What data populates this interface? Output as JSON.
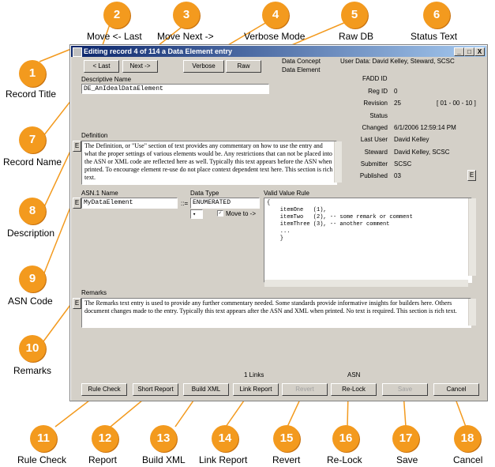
{
  "callouts": [
    {
      "num": "1",
      "label": "Record Title"
    },
    {
      "num": "2",
      "label": "Move <- Last"
    },
    {
      "num": "3",
      "label": "Move Next ->"
    },
    {
      "num": "4",
      "label": "Verbose Mode"
    },
    {
      "num": "5",
      "label": "Raw DB"
    },
    {
      "num": "6",
      "label": "Status Text"
    },
    {
      "num": "7",
      "label": "Record Name"
    },
    {
      "num": "8",
      "label": "Description"
    },
    {
      "num": "9",
      "label": "ASN Code"
    },
    {
      "num": "10",
      "label": "Remarks"
    },
    {
      "num": "11",
      "label": "Rule Check"
    },
    {
      "num": "12",
      "label": "Report"
    },
    {
      "num": "13",
      "label": "Build XML"
    },
    {
      "num": "14",
      "label": "Link Report"
    },
    {
      "num": "15",
      "label": "Revert"
    },
    {
      "num": "16",
      "label": "Re-Lock"
    },
    {
      "num": "17",
      "label": "Save"
    },
    {
      "num": "18",
      "label": "Cancel"
    }
  ],
  "window": {
    "title": "Editing record 4 of 114 a Data Element entry",
    "minimize": "_",
    "maximize": "□",
    "close": "X"
  },
  "toolbar": {
    "last_label": "< Last",
    "next_label": "Next ->",
    "verbose_label": "Verbose",
    "raw_label": "Raw",
    "concept_line1": "Data Concept",
    "concept_line2": "Data Element",
    "user_data": "User Data:  David Kelley, Steward, SCSC"
  },
  "descriptive_name": {
    "label": "Descriptive Name",
    "value": "DE_AnIdealDataElement"
  },
  "status": {
    "fadd_id": "FADD ID",
    "rows": [
      {
        "label": "Reg ID",
        "value": "0"
      },
      {
        "label": "Revision",
        "value": "25"
      },
      {
        "label": "Status",
        "value": ""
      },
      {
        "label": "Changed",
        "value": "6/1/2006 12:59:14 PM"
      },
      {
        "label": "Last User",
        "value": "David Kelley"
      },
      {
        "label": "Steward",
        "value": "David Kelley, SCSC"
      },
      {
        "label": "Submitter",
        "value": "SCSC"
      },
      {
        "label": "Published",
        "value": "03"
      }
    ],
    "revision_range": "[ 01 - 00 - 10 ]",
    "edit_button": "E"
  },
  "definition": {
    "label": "Definition",
    "edit_button": "E",
    "text": "The Definition, or \"Use\" section of text provides any commentary on how to use the entry and what the proper settings of various elements would be.  Any restrictions that can not be placed into the ASN or XML code are reflected here as well. Typically this text appears before the ASN when printed.  To encourage element re-use do not place context dependent text here.  This section is rich text."
  },
  "asn": {
    "name_label": "ASN.1 Name",
    "name_value": "MyDataElement",
    "edit_button": "E",
    "assign": "::=",
    "type_label": "Data Type",
    "type_value": "ENUMERATED",
    "move_to": "Move to ->",
    "rule_label": "Valid Value Rule",
    "rule_code": "{\n    itemOne   (1),\n    itemTwo   (2), -- some remark or comment\n    itemThree (3), -- another comment\n    ...\n    }"
  },
  "remarks": {
    "label": "Remarks",
    "edit_button": "E",
    "text": "The Remarks text entry is used to provide any further commentary needed. Some standards provide informative insights for builders here. Others document changes made to the entry.  Typically this text appears after the ASN and XML when printed.  No text is required.  This section is rich text."
  },
  "bottom": {
    "links_count": "1 Links",
    "asn_label": "ASN",
    "rule_check": "Rule Check",
    "short_report": "Short Report",
    "build_xml": "Build XML",
    "link_report": "Link Report",
    "revert": "Revert",
    "relock": "Re-Lock",
    "save": "Save",
    "cancel": "Cancel"
  },
  "colors": {
    "callout": "#f39a1e",
    "titlebar": "#0a246a",
    "window": "#d4d0c8"
  }
}
